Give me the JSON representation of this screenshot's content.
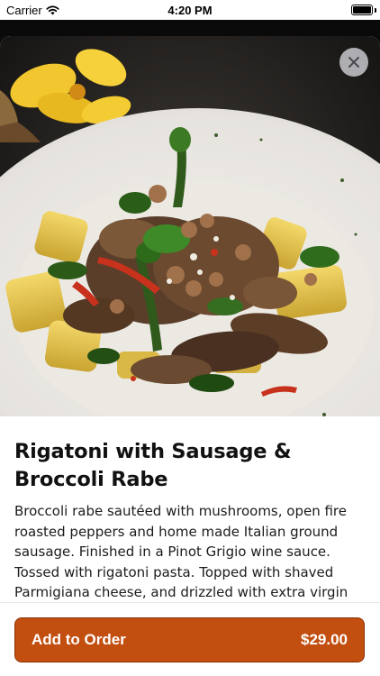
{
  "status_bar": {
    "carrier": "Carrier",
    "time": "4:20 PM",
    "icons": [
      "wifi-icon",
      "battery-icon"
    ]
  },
  "hero": {
    "image": "pasta-dish-photo",
    "close_icon": "close-icon"
  },
  "item": {
    "title": "Rigatoni with Sausage & Broccoli Rabe",
    "description": "Broccoli rabe sautéed with mushrooms, open fire roasted peppers and home made Italian ground sausage. Finished in a Pinot Grigio wine sauce. Tossed with rigatoni pasta. Topped with shaved Parmigiana cheese, and drizzled with extra virgin olive oil."
  },
  "footer": {
    "add_label": "Add to Order",
    "price": "$29.00"
  },
  "colors": {
    "accent": "#c24e0f",
    "accent_border": "#8a3205",
    "backdrop": "#0a0a0a"
  }
}
